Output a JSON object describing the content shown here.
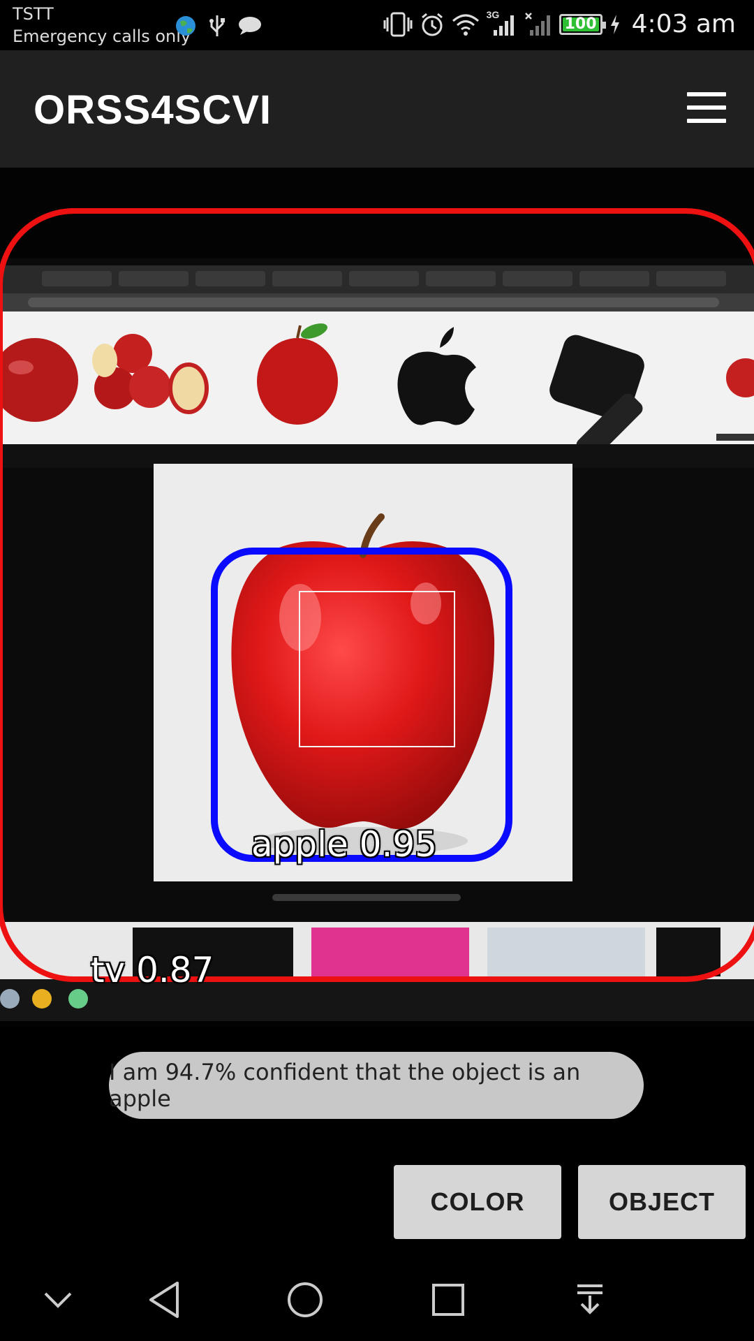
{
  "status_bar": {
    "carrier": "TSTT",
    "carrier_status": "Emergency calls only",
    "network_type": "3G",
    "battery_level": "100",
    "time": "4:03 am",
    "left_icons": [
      "globe-icon",
      "usb-icon",
      "message-icon"
    ],
    "right_icons": [
      "vibrate-icon",
      "alarm-icon",
      "wifi-icon",
      "signal-icon",
      "no-signal-icon",
      "battery-icon",
      "charging-icon"
    ]
  },
  "app_bar": {
    "title": "ORSS4SCVI",
    "menu_icon": "hamburger-menu-icon"
  },
  "detections": [
    {
      "label": "apple",
      "score": "0.95",
      "text": "apple 0.95",
      "color": "#0a0aff"
    },
    {
      "label": "tv",
      "score": "0.87",
      "text": "tv 0.87",
      "color": "#ee1111"
    }
  ],
  "toast": {
    "text": "I am 94.7% confident that the object is an apple"
  },
  "buttons": {
    "color": "COLOR",
    "object": "OBJECT"
  },
  "nav_bar": {
    "icons": [
      "chevron-down-icon",
      "back-icon",
      "home-icon",
      "recents-icon",
      "notification-pull-icon"
    ]
  },
  "colors": {
    "app_bar": "#202020",
    "toast_bg": "#c8c8c8",
    "button_bg": "#d6d6d6"
  }
}
